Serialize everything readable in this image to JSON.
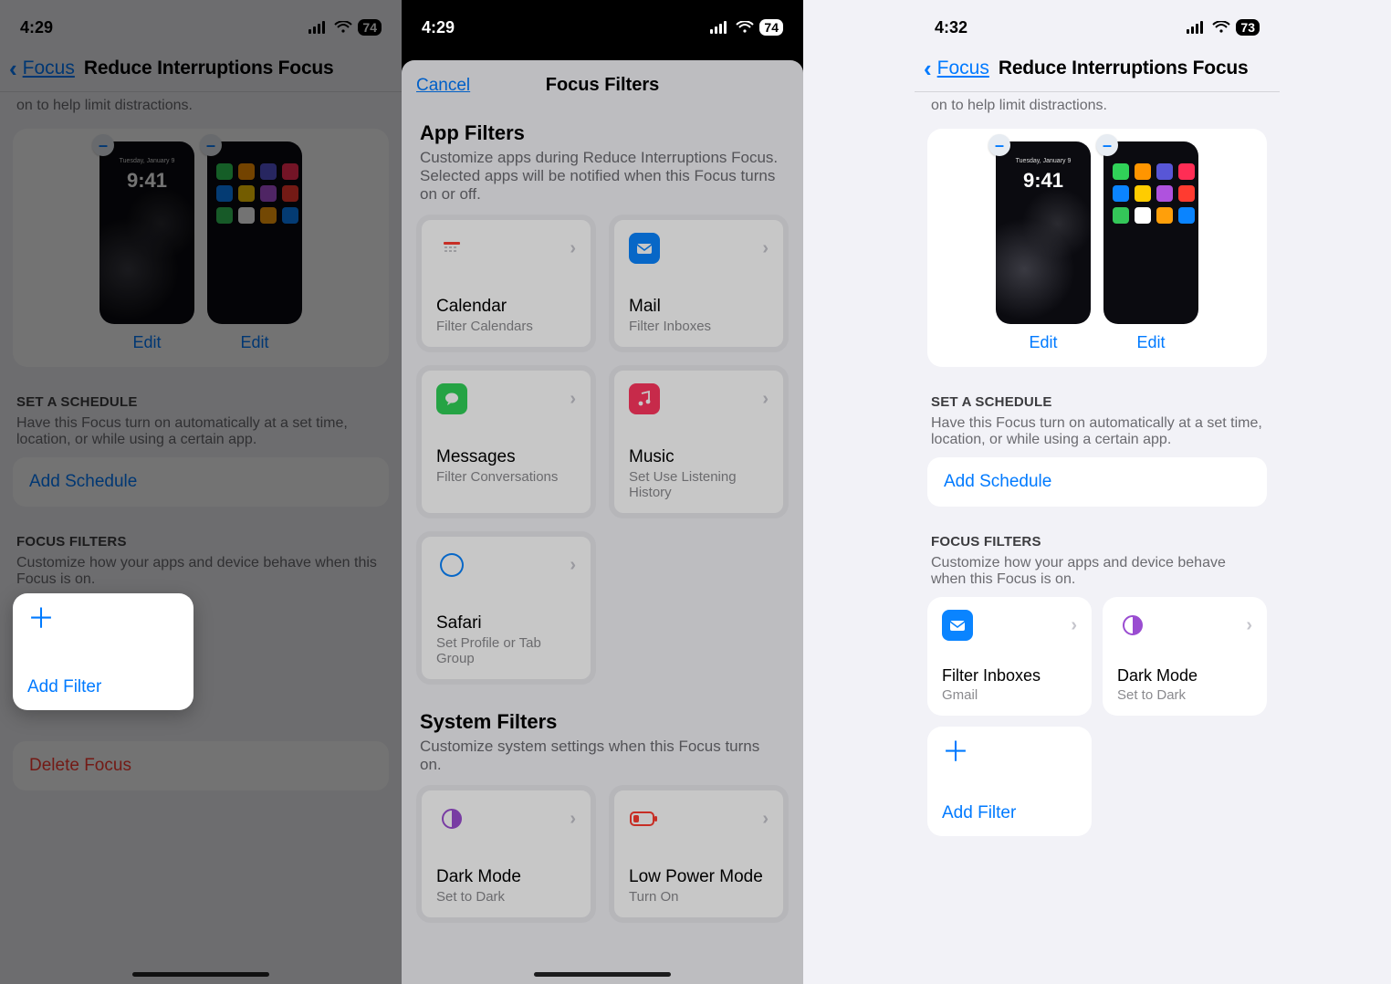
{
  "panel1": {
    "status": {
      "time": "4:29",
      "battery": "74"
    },
    "nav": {
      "back": "Focus",
      "title": "Reduce Interruptions Focus"
    },
    "hint_partial": "on to help limit distractions.",
    "preview": {
      "lock_time": "9:41",
      "lock_date": "Tuesday, January 9",
      "edit_left": "Edit",
      "edit_right": "Edit"
    },
    "schedule": {
      "header": "SET A SCHEDULE",
      "sub": "Have this Focus turn on automatically at a set time, location, or while using a certain app.",
      "add": "Add Schedule"
    },
    "filters": {
      "header": "FOCUS FILTERS",
      "sub": "Customize how your apps and device behave when this Focus is on.",
      "add": "Add Filter"
    },
    "delete": "Delete Focus"
  },
  "panel2": {
    "status": {
      "time": "4:29",
      "battery": "74"
    },
    "sheet": {
      "cancel": "Cancel",
      "title": "Focus Filters",
      "app_section": {
        "title": "App Filters",
        "sub": "Customize apps during Reduce Interruptions Focus. Selected apps will be notified when this Focus turns on or off.",
        "items": [
          {
            "name": "Calendar",
            "sub": "Filter Calendars"
          },
          {
            "name": "Mail",
            "sub": "Filter Inboxes"
          },
          {
            "name": "Messages",
            "sub": "Filter Conversations"
          },
          {
            "name": "Music",
            "sub": "Set Use Listening History"
          },
          {
            "name": "Safari",
            "sub": "Set Profile or Tab Group"
          }
        ]
      },
      "system_section": {
        "title": "System Filters",
        "sub": "Customize system settings when this Focus turns on.",
        "items": [
          {
            "name": "Dark Mode",
            "sub": "Set to Dark"
          },
          {
            "name": "Low Power Mode",
            "sub": "Turn On"
          }
        ]
      }
    }
  },
  "panel3": {
    "status": {
      "time": "4:32",
      "battery": "73"
    },
    "nav": {
      "back": "Focus",
      "title": "Reduce Interruptions Focus"
    },
    "hint_partial": "on to help limit distractions.",
    "preview": {
      "lock_time": "9:41",
      "lock_date": "Tuesday, January 9",
      "edit_left": "Edit",
      "edit_right": "Edit"
    },
    "schedule": {
      "header": "SET A SCHEDULE",
      "sub": "Have this Focus turn on automatically at a set time, location, or while using a certain app.",
      "add": "Add Schedule"
    },
    "filters": {
      "header": "FOCUS FILTERS",
      "sub": "Customize how your apps and device behave when this Focus is on.",
      "items": [
        {
          "name": "Filter Inboxes",
          "sub": "Gmail"
        },
        {
          "name": "Dark Mode",
          "sub": "Set to Dark"
        }
      ],
      "add": "Add Filter"
    }
  },
  "icons": {
    "signal": "signal-icon",
    "wifi": "wifi-icon",
    "battery": "battery-icon"
  }
}
